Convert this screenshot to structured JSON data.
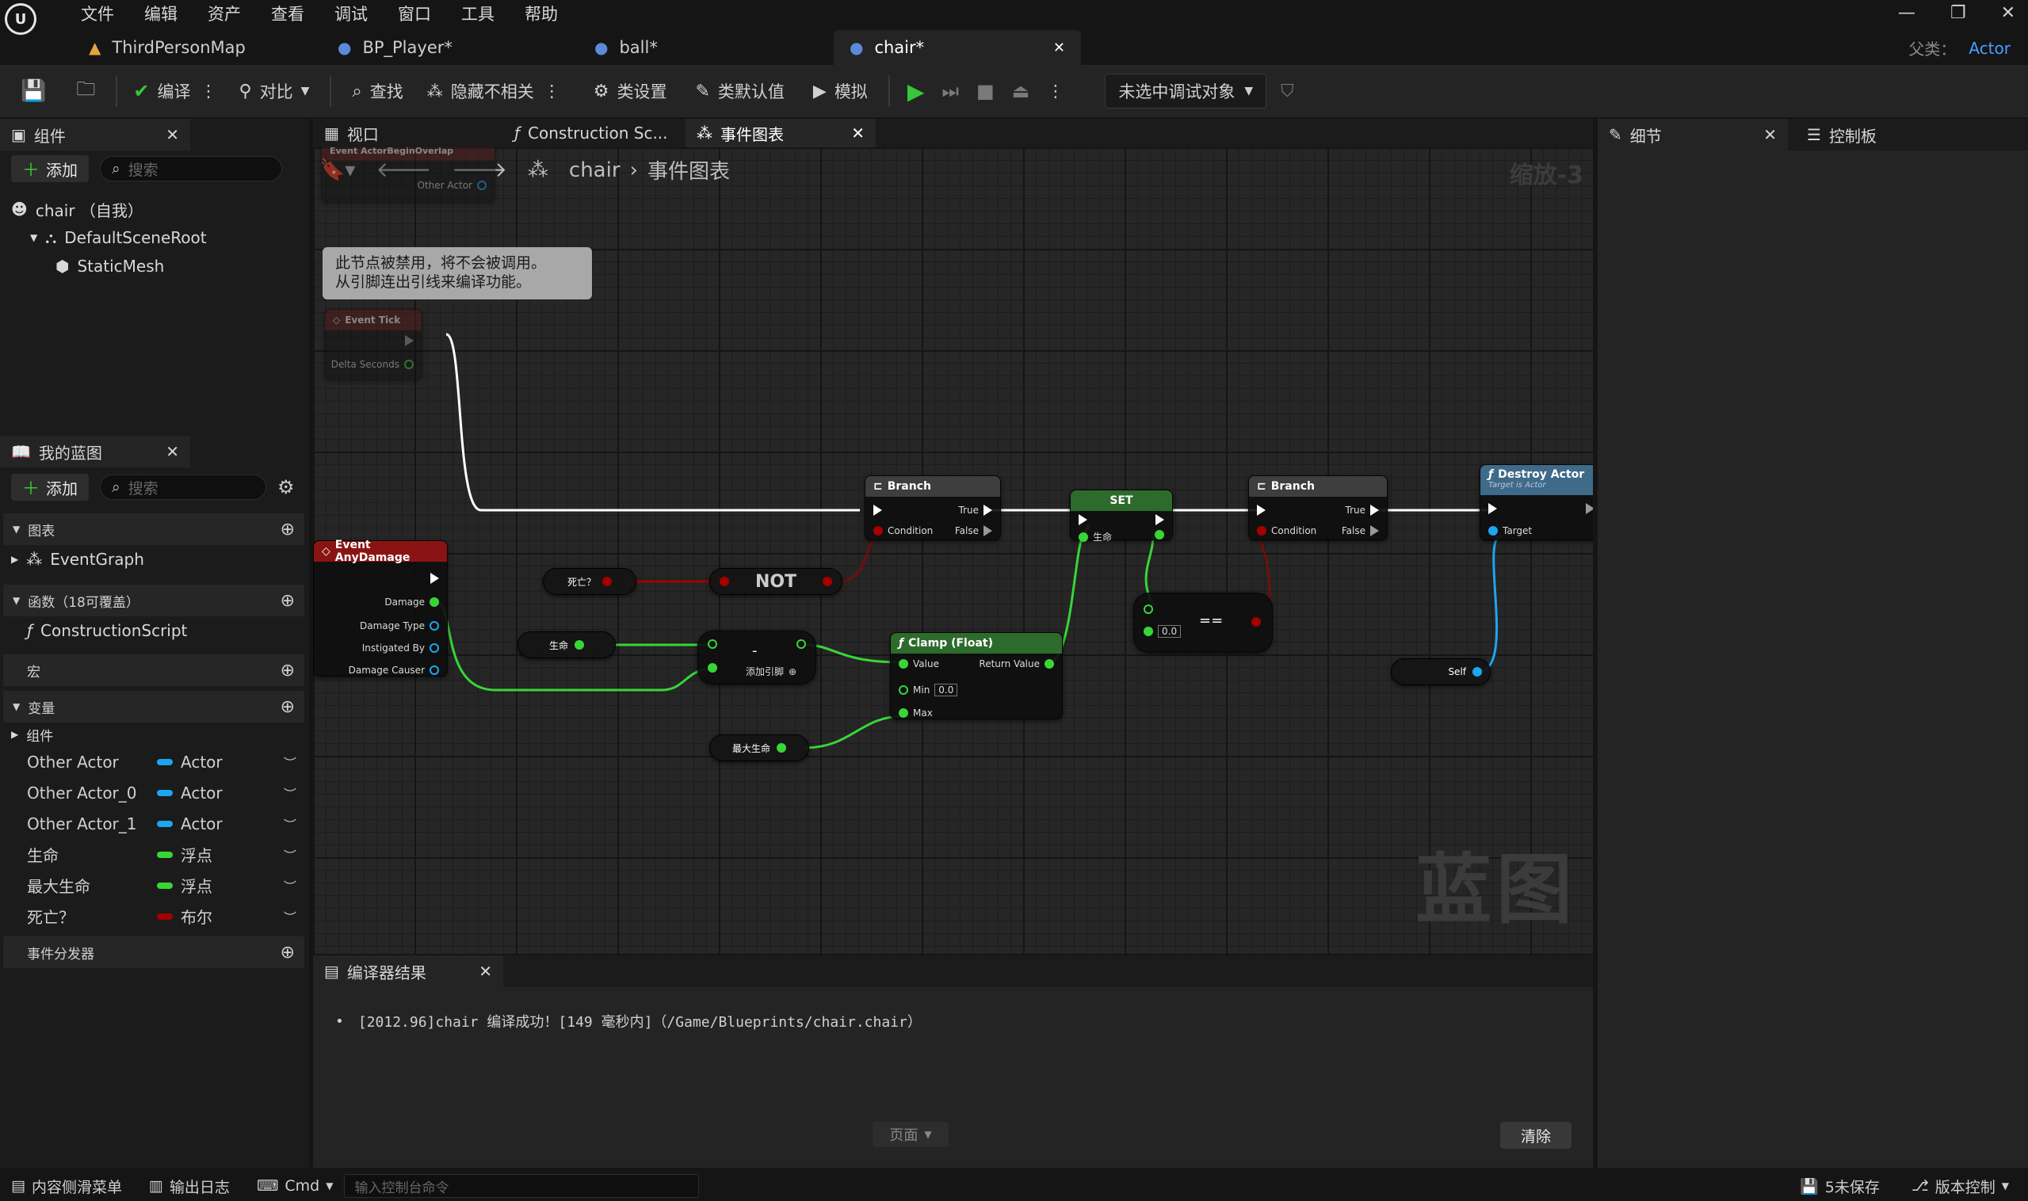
{
  "menu": [
    "文件",
    "编辑",
    "资产",
    "查看",
    "调试",
    "窗口",
    "工具",
    "帮助"
  ],
  "tabs": [
    {
      "label": "ThirdPersonMap"
    },
    {
      "label": "BP_Player*"
    },
    {
      "label": "ball*"
    },
    {
      "label": "chair*"
    }
  ],
  "parent_label": "父类：",
  "parent_value": "Actor",
  "toolbar": {
    "compile": "编译",
    "diff": "对比",
    "find": "查找",
    "hide": "隐藏不相关",
    "class_settings": "类设置",
    "class_defaults": "类默认值",
    "simulate": "模拟",
    "debug_target": "未选中调试对象"
  },
  "components": {
    "tab": "组件",
    "add": "添加",
    "search": "搜索",
    "items": [
      "chair （自我）",
      "DefaultSceneRoot",
      "StaticMesh"
    ]
  },
  "mybp": {
    "tab": "我的蓝图",
    "add": "添加",
    "search": "搜索",
    "graphs": "图表",
    "event_graph": "EventGraph",
    "functions": "函数（18可覆盖）",
    "construction": "ConstructionScript",
    "macros": "宏",
    "variables": "变量",
    "components_cat": "组件",
    "vars": [
      {
        "name": "Other Actor",
        "type": "Actor",
        "color": "#1ea5f0"
      },
      {
        "name": "Other Actor_0",
        "type": "Actor",
        "color": "#1ea5f0"
      },
      {
        "name": "Other Actor_1",
        "type": "Actor",
        "color": "#1ea5f0"
      },
      {
        "name": "生命",
        "type": "浮点",
        "color": "#38d538"
      },
      {
        "name": "最大生命",
        "type": "浮点",
        "color": "#38d538"
      },
      {
        "name": "死亡？",
        "type": "布尔",
        "color": "#a30000"
      }
    ],
    "dispatchers": "事件分发器"
  },
  "graph_tabs": {
    "viewport": "视口",
    "construction": "Construction Sc...",
    "event_graph": "事件图表"
  },
  "graph": {
    "crumb1": "chair",
    "crumb2": "事件图表",
    "zoom": "缩放-3",
    "watermark": "蓝图",
    "disabled_comment": [
      "此节点被禁用，将不会被调用。",
      "从引脚连出引线来编译功能。"
    ],
    "nodes": {
      "overlap_top": "Event ActorBeginOverlap",
      "other_actor": "Other Actor",
      "event_tick": "Event Tick",
      "delta": "Delta Seconds",
      "any_damage": "Event AnyDamage",
      "damage": "Damage",
      "damage_type": "Damage Type",
      "instigated": "Instigated By",
      "causer": "Damage Causer",
      "branch": "Branch",
      "condition": "Condition",
      "true": "True",
      "false": "False",
      "set": "SET",
      "life": "生命",
      "death": "死亡？",
      "not": "NOT",
      "minus": "-",
      "add_pin": "添加引脚",
      "clamp": "Clamp (Float)",
      "value": "Value",
      "min": "Min",
      "min_val": "0.0",
      "max": "Max",
      "return": "Return Value",
      "max_life": "最大生命",
      "eq": "==",
      "eq_val": "0.0",
      "destroy": "Destroy Actor",
      "destroy_sub": "Target is Actor",
      "target": "Target",
      "self": "Self"
    }
  },
  "details": {
    "tab": "细节",
    "control": "控制板"
  },
  "compiler": {
    "tab": "编译器结果",
    "message": "[2012.96]chair 编译成功！[149 毫秒内]（/Game/Blueprints/chair.chair）",
    "page": "页面",
    "clear": "清除"
  },
  "status": {
    "drawer": "内容侧滑菜单",
    "output": "输出日志",
    "cmd": "Cmd",
    "console": "输入控制台命令",
    "unsaved": "5未保存",
    "vcs": "版本控制"
  },
  "colors": {
    "accent": "#4a9eff",
    "exec": "#ffffff",
    "float": "#38d538",
    "bool": "#a30000",
    "object": "#1ea5f0",
    "event_header": "#8a1414",
    "function_header": "#2d6b2d",
    "branch_header": "#3e3e3e"
  }
}
